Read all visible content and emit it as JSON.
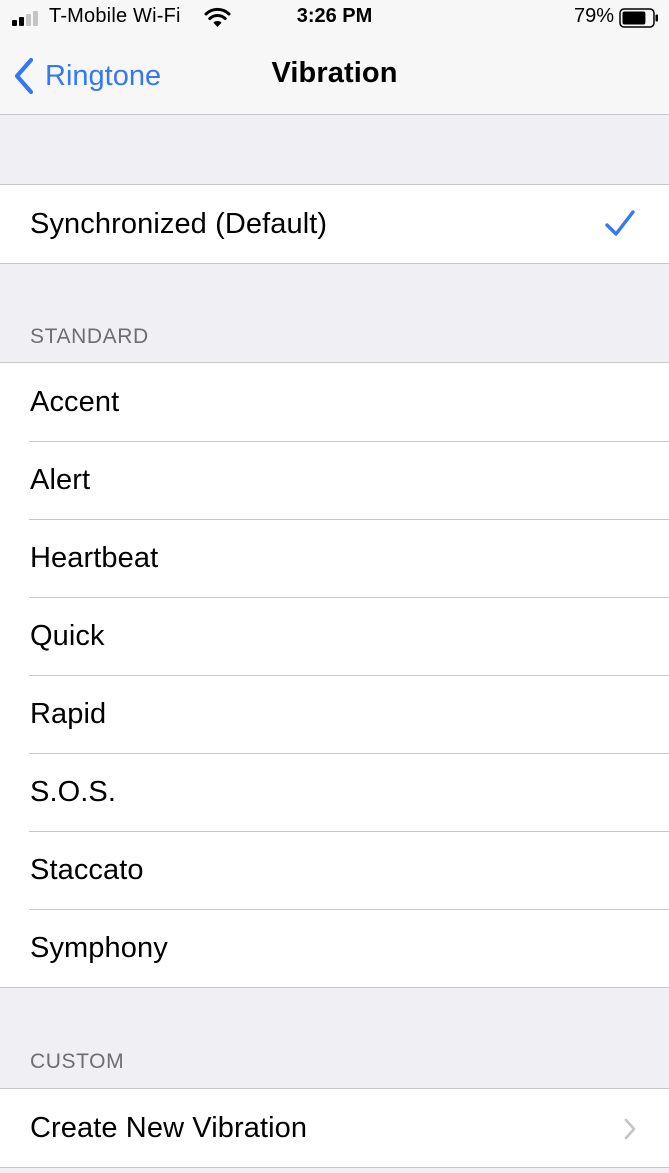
{
  "status_bar": {
    "carrier": "T-Mobile Wi-Fi",
    "time": "3:26 PM",
    "battery_percent": "79%",
    "battery_level": 0.79,
    "signal_bars": 2,
    "signal_bars_total": 4,
    "icons": [
      "signal-icon",
      "wifi-icon",
      "battery-icon"
    ]
  },
  "nav": {
    "back_label": "Ringtone",
    "title": "Vibration",
    "back_icon": "chevron-left-icon"
  },
  "colors": {
    "accent": "#3478f6",
    "background": "#efeff4",
    "section_header": "#6d6d72",
    "separator": "#c8c7cc"
  },
  "default_group": {
    "items": [
      {
        "label": "Synchronized (Default)",
        "selected": true
      }
    ]
  },
  "standard": {
    "header": "STANDARD",
    "items": [
      {
        "label": "Accent"
      },
      {
        "label": "Alert"
      },
      {
        "label": "Heartbeat"
      },
      {
        "label": "Quick"
      },
      {
        "label": "Rapid"
      },
      {
        "label": "S.O.S."
      },
      {
        "label": "Staccato"
      },
      {
        "label": "Symphony"
      }
    ]
  },
  "custom": {
    "header": "CUSTOM",
    "items": [
      {
        "label": "Create New Vibration",
        "disclosure": true
      }
    ]
  }
}
